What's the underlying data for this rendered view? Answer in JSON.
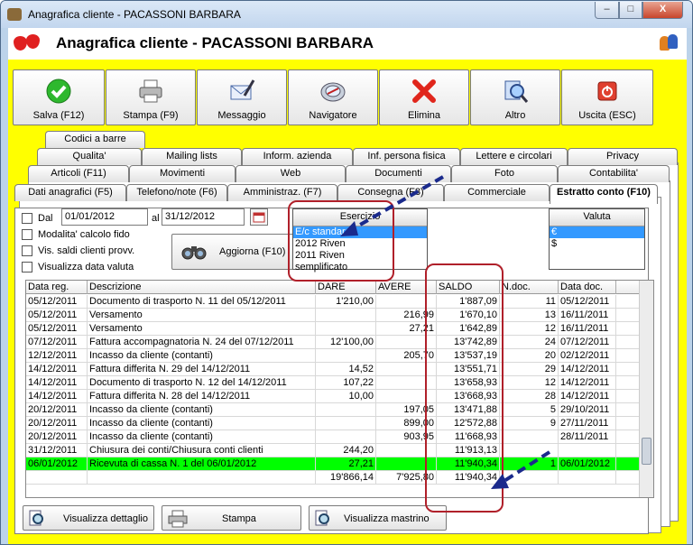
{
  "window": {
    "title": "Anagrafica cliente - PACASSONI BARBARA",
    "min": "–",
    "max": "□",
    "close": "X"
  },
  "header": {
    "title": "Anagrafica cliente - PACASSONI BARBARA"
  },
  "toolbar": [
    {
      "label": "Salva (F12)",
      "icon": "check-icon"
    },
    {
      "label": "Stampa (F9)",
      "icon": "printer-icon"
    },
    {
      "label": "Messaggio",
      "icon": "envelope-pen-icon"
    },
    {
      "label": "Navigatore",
      "icon": "compass-icon"
    },
    {
      "label": "Elimina",
      "icon": "red-x-icon"
    },
    {
      "label": "Altro",
      "icon": "magnifier-icon"
    },
    {
      "label": "Uscita (ESC)",
      "icon": "power-icon"
    }
  ],
  "tabs": {
    "row1": [
      "Codici a barre"
    ],
    "row2": [
      "Qualita'",
      "Mailing lists",
      "Inform. azienda",
      "Inf. persona fisica",
      "Lettere e circolari",
      "Privacy"
    ],
    "row3": [
      "Articoli (F11)",
      "Movimenti",
      "Web",
      "Documenti",
      "Foto",
      "Contabilita'"
    ],
    "row4": [
      "Dati anagrafici (F5)",
      "Telefono/note (F6)",
      "Amministraz. (F7)",
      "Consegna (F8)",
      "Commerciale",
      "Estratto conto (F10)"
    ]
  },
  "filters": {
    "dal_label": "Dal",
    "dal_value": "01/01/2012",
    "al_label": "al",
    "al_value": "31/12/2012",
    "checkboxes": [
      "Modalita' calcolo fido",
      "Vis. saldi clienti provv.",
      "Visualizza data valuta"
    ],
    "aggiorna": "Aggiorna (F10)"
  },
  "esercizio": {
    "header": "Esercizio",
    "items": [
      "E/c standard",
      "2012 Riven",
      "2011 Riven",
      "semplificato"
    ],
    "selected": 0
  },
  "valuta": {
    "header": "Valuta",
    "items": [
      "€",
      "$"
    ],
    "selected": 0
  },
  "table": {
    "columns": [
      "Data reg.",
      "Descrizione",
      "DARE",
      "AVERE",
      "SALDO",
      "N.doc.",
      "Data doc."
    ],
    "rows": [
      [
        "05/12/2011",
        "Documento di trasporto N. 11 del 05/12/2011",
        "1'210,00",
        "",
        "1'887,09",
        "11",
        "05/12/2011"
      ],
      [
        "05/12/2011",
        "Versamento",
        "",
        "216,99",
        "1'670,10",
        "13",
        "16/11/2011"
      ],
      [
        "05/12/2011",
        "Versamento",
        "",
        "27,21",
        "1'642,89",
        "12",
        "16/11/2011"
      ],
      [
        "07/12/2011",
        "Fattura accompagnatoria N. 24 del 07/12/2011",
        "12'100,00",
        "",
        "13'742,89",
        "24",
        "07/12/2011"
      ],
      [
        "12/12/2011",
        "Incasso da cliente (contanti)",
        "",
        "205,70",
        "13'537,19",
        "20",
        "02/12/2011"
      ],
      [
        "14/12/2011",
        "Fattura differita N. 29 del 14/12/2011",
        "14,52",
        "",
        "13'551,71",
        "29",
        "14/12/2011"
      ],
      [
        "14/12/2011",
        "Documento di trasporto N. 12 del 14/12/2011",
        "107,22",
        "",
        "13'658,93",
        "12",
        "14/12/2011"
      ],
      [
        "14/12/2011",
        "Fattura differita N. 28 del 14/12/2011",
        "10,00",
        "",
        "13'668,93",
        "28",
        "14/12/2011"
      ],
      [
        "20/12/2011",
        "Incasso da cliente (contanti)",
        "",
        "197,05",
        "13'471,88",
        "5",
        "29/10/2011"
      ],
      [
        "20/12/2011",
        "Incasso da cliente (contanti)",
        "",
        "899,00",
        "12'572,88",
        "9",
        "27/11/2011"
      ],
      [
        "20/12/2011",
        "Incasso da cliente (contanti)",
        "",
        "903,95",
        "11'668,93",
        "",
        "28/11/2011"
      ],
      [
        "31/12/2011",
        "Chiusura dei conti/Chiusura conti clienti",
        "244,20",
        "",
        "11'913,13",
        "",
        ""
      ],
      [
        "06/01/2012",
        "Ricevuta di cassa N. 1 del 06/01/2012",
        "27,21",
        "",
        "11'940,34",
        "1",
        "06/01/2012"
      ]
    ],
    "highlight_row": 12,
    "highlight_color": "#00ff00",
    "totals": [
      "",
      "",
      "19'866,14",
      "7'925,80",
      "11'940,34",
      "",
      ""
    ]
  },
  "bottom_buttons": [
    "Visualizza dettaglio",
    "Stampa",
    "Visualizza mastrino"
  ],
  "colors": {
    "background": "#ffff00",
    "highlight": "#00ff00",
    "annotation_red": "#b0202a",
    "annotation_arrow": "#1a2a8c"
  }
}
